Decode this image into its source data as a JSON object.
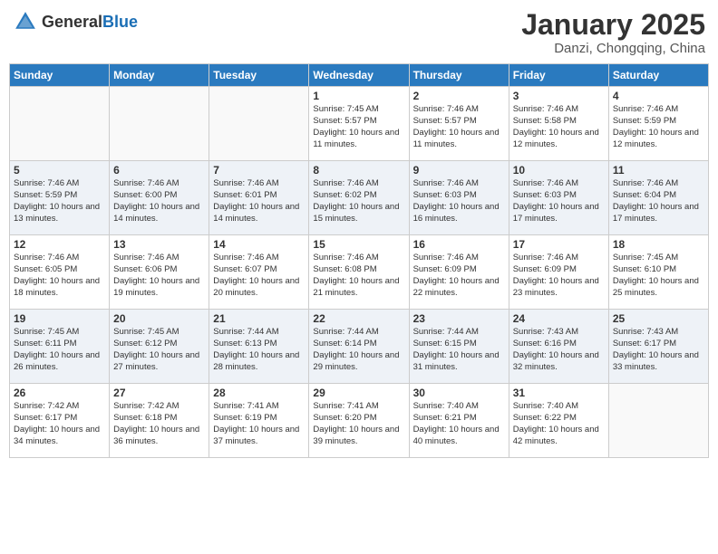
{
  "header": {
    "logo_general": "General",
    "logo_blue": "Blue",
    "month_title": "January 2025",
    "location": "Danzi, Chongqing, China"
  },
  "weekdays": [
    "Sunday",
    "Monday",
    "Tuesday",
    "Wednesday",
    "Thursday",
    "Friday",
    "Saturday"
  ],
  "weeks": [
    [
      {
        "day": "",
        "sunrise": "",
        "sunset": "",
        "daylight": ""
      },
      {
        "day": "",
        "sunrise": "",
        "sunset": "",
        "daylight": ""
      },
      {
        "day": "",
        "sunrise": "",
        "sunset": "",
        "daylight": ""
      },
      {
        "day": "1",
        "sunrise": "Sunrise: 7:45 AM",
        "sunset": "Sunset: 5:57 PM",
        "daylight": "Daylight: 10 hours and 11 minutes."
      },
      {
        "day": "2",
        "sunrise": "Sunrise: 7:46 AM",
        "sunset": "Sunset: 5:57 PM",
        "daylight": "Daylight: 10 hours and 11 minutes."
      },
      {
        "day": "3",
        "sunrise": "Sunrise: 7:46 AM",
        "sunset": "Sunset: 5:58 PM",
        "daylight": "Daylight: 10 hours and 12 minutes."
      },
      {
        "day": "4",
        "sunrise": "Sunrise: 7:46 AM",
        "sunset": "Sunset: 5:59 PM",
        "daylight": "Daylight: 10 hours and 12 minutes."
      }
    ],
    [
      {
        "day": "5",
        "sunrise": "Sunrise: 7:46 AM",
        "sunset": "Sunset: 5:59 PM",
        "daylight": "Daylight: 10 hours and 13 minutes."
      },
      {
        "day": "6",
        "sunrise": "Sunrise: 7:46 AM",
        "sunset": "Sunset: 6:00 PM",
        "daylight": "Daylight: 10 hours and 14 minutes."
      },
      {
        "day": "7",
        "sunrise": "Sunrise: 7:46 AM",
        "sunset": "Sunset: 6:01 PM",
        "daylight": "Daylight: 10 hours and 14 minutes."
      },
      {
        "day": "8",
        "sunrise": "Sunrise: 7:46 AM",
        "sunset": "Sunset: 6:02 PM",
        "daylight": "Daylight: 10 hours and 15 minutes."
      },
      {
        "day": "9",
        "sunrise": "Sunrise: 7:46 AM",
        "sunset": "Sunset: 6:03 PM",
        "daylight": "Daylight: 10 hours and 16 minutes."
      },
      {
        "day": "10",
        "sunrise": "Sunrise: 7:46 AM",
        "sunset": "Sunset: 6:03 PM",
        "daylight": "Daylight: 10 hours and 17 minutes."
      },
      {
        "day": "11",
        "sunrise": "Sunrise: 7:46 AM",
        "sunset": "Sunset: 6:04 PM",
        "daylight": "Daylight: 10 hours and 17 minutes."
      }
    ],
    [
      {
        "day": "12",
        "sunrise": "Sunrise: 7:46 AM",
        "sunset": "Sunset: 6:05 PM",
        "daylight": "Daylight: 10 hours and 18 minutes."
      },
      {
        "day": "13",
        "sunrise": "Sunrise: 7:46 AM",
        "sunset": "Sunset: 6:06 PM",
        "daylight": "Daylight: 10 hours and 19 minutes."
      },
      {
        "day": "14",
        "sunrise": "Sunrise: 7:46 AM",
        "sunset": "Sunset: 6:07 PM",
        "daylight": "Daylight: 10 hours and 20 minutes."
      },
      {
        "day": "15",
        "sunrise": "Sunrise: 7:46 AM",
        "sunset": "Sunset: 6:08 PM",
        "daylight": "Daylight: 10 hours and 21 minutes."
      },
      {
        "day": "16",
        "sunrise": "Sunrise: 7:46 AM",
        "sunset": "Sunset: 6:09 PM",
        "daylight": "Daylight: 10 hours and 22 minutes."
      },
      {
        "day": "17",
        "sunrise": "Sunrise: 7:46 AM",
        "sunset": "Sunset: 6:09 PM",
        "daylight": "Daylight: 10 hours and 23 minutes."
      },
      {
        "day": "18",
        "sunrise": "Sunrise: 7:45 AM",
        "sunset": "Sunset: 6:10 PM",
        "daylight": "Daylight: 10 hours and 25 minutes."
      }
    ],
    [
      {
        "day": "19",
        "sunrise": "Sunrise: 7:45 AM",
        "sunset": "Sunset: 6:11 PM",
        "daylight": "Daylight: 10 hours and 26 minutes."
      },
      {
        "day": "20",
        "sunrise": "Sunrise: 7:45 AM",
        "sunset": "Sunset: 6:12 PM",
        "daylight": "Daylight: 10 hours and 27 minutes."
      },
      {
        "day": "21",
        "sunrise": "Sunrise: 7:44 AM",
        "sunset": "Sunset: 6:13 PM",
        "daylight": "Daylight: 10 hours and 28 minutes."
      },
      {
        "day": "22",
        "sunrise": "Sunrise: 7:44 AM",
        "sunset": "Sunset: 6:14 PM",
        "daylight": "Daylight: 10 hours and 29 minutes."
      },
      {
        "day": "23",
        "sunrise": "Sunrise: 7:44 AM",
        "sunset": "Sunset: 6:15 PM",
        "daylight": "Daylight: 10 hours and 31 minutes."
      },
      {
        "day": "24",
        "sunrise": "Sunrise: 7:43 AM",
        "sunset": "Sunset: 6:16 PM",
        "daylight": "Daylight: 10 hours and 32 minutes."
      },
      {
        "day": "25",
        "sunrise": "Sunrise: 7:43 AM",
        "sunset": "Sunset: 6:17 PM",
        "daylight": "Daylight: 10 hours and 33 minutes."
      }
    ],
    [
      {
        "day": "26",
        "sunrise": "Sunrise: 7:42 AM",
        "sunset": "Sunset: 6:17 PM",
        "daylight": "Daylight: 10 hours and 34 minutes."
      },
      {
        "day": "27",
        "sunrise": "Sunrise: 7:42 AM",
        "sunset": "Sunset: 6:18 PM",
        "daylight": "Daylight: 10 hours and 36 minutes."
      },
      {
        "day": "28",
        "sunrise": "Sunrise: 7:41 AM",
        "sunset": "Sunset: 6:19 PM",
        "daylight": "Daylight: 10 hours and 37 minutes."
      },
      {
        "day": "29",
        "sunrise": "Sunrise: 7:41 AM",
        "sunset": "Sunset: 6:20 PM",
        "daylight": "Daylight: 10 hours and 39 minutes."
      },
      {
        "day": "30",
        "sunrise": "Sunrise: 7:40 AM",
        "sunset": "Sunset: 6:21 PM",
        "daylight": "Daylight: 10 hours and 40 minutes."
      },
      {
        "day": "31",
        "sunrise": "Sunrise: 7:40 AM",
        "sunset": "Sunset: 6:22 PM",
        "daylight": "Daylight: 10 hours and 42 minutes."
      },
      {
        "day": "",
        "sunrise": "",
        "sunset": "",
        "daylight": ""
      }
    ]
  ]
}
